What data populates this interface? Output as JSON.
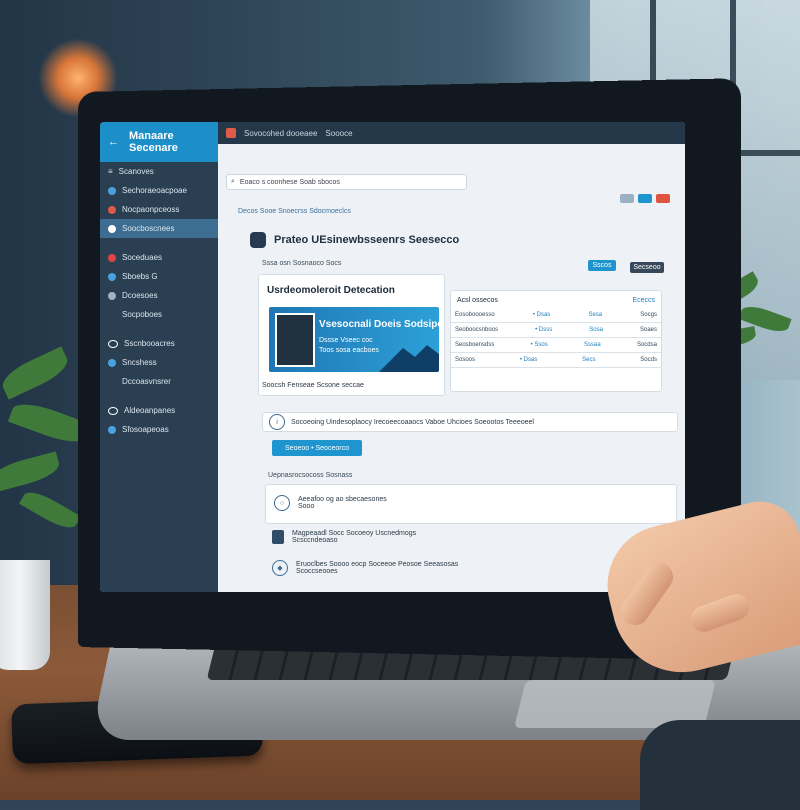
{
  "scene": {
    "description_colors": {
      "accent": "#1e95cf",
      "sidebar": "#2a3f52",
      "topbar": "#253849"
    }
  },
  "app": {
    "sidebar_title": "Manaare Secenare",
    "sidebar_items": [
      {
        "label": "Scanoves",
        "icon": "menu-icon"
      },
      {
        "label": "Sechoraeoacpoae",
        "icon": "user-icon"
      },
      {
        "label": "Nocpaonpceoss",
        "icon": "folder-icon"
      },
      {
        "label": "Soocboscnees",
        "icon": "user-icon"
      },
      {
        "label": "Soceduaes",
        "icon": "alert-icon"
      },
      {
        "label": "Sboebs G",
        "icon": "cloud-icon"
      },
      {
        "label": "Dcoesoes",
        "icon": "document-icon"
      },
      {
        "label": "Socpoboes",
        "icon": "settings-icon"
      },
      {
        "label": "Sscnbooacres",
        "icon": "eye-icon"
      },
      {
        "label": "Sncshess",
        "icon": "check-icon"
      },
      {
        "label": "Dccoasvnsrer",
        "icon": "list-icon"
      },
      {
        "label": "Aldeoanpanes",
        "icon": "shield-icon"
      },
      {
        "label": "Sfosoapeoas",
        "icon": "gear-icon"
      }
    ],
    "topbar": {
      "tab_label": "Sovocohed dooeaee",
      "second_label": "Soooce",
      "search_text": "Eoaco s coonhese Soab sbocos"
    },
    "breadcrumb": "Decos Sooe Snoecrss Sdocmoeclcs",
    "page_title": "Prateo UEsinewbsseenrs Seesecco",
    "sub_tabs": "Sssa osn Sosnaoco Socs",
    "buttons": {
      "primary": "Sscos",
      "secondary": "Secseoo",
      "action": "Seoeoo • Seoceorco"
    },
    "card_left": {
      "title": "Usrdeomoleroit Detecation",
      "image_headline": "Vsesocnali Doeis Sodsipes",
      "image_line1": "Dssse Vseec coc",
      "image_line2": "Toos sosa eacboes",
      "footer": "Soocsh Fenseae Scsone  seccae"
    },
    "card_right": {
      "title": "Acsl ossecos",
      "link": "Ececcs",
      "rows": [
        {
          "label": "Eosoboooesso",
          "mid": "• Dsas",
          "value": "Sesa",
          "right": "Socgs"
        },
        {
          "label": "Seoboocsnboos",
          "mid": "• Dsss",
          "value": "Sosa",
          "right": "Soaes"
        },
        {
          "label": "Seosboensdss",
          "mid": "• Ssos",
          "value": "Sssaa",
          "right": "Socdsa"
        },
        {
          "label": "Sosoos",
          "mid": "• Dsas",
          "value": "Secs",
          "right": "Socds"
        }
      ]
    },
    "info_bar": "Socoeoing Uindesoplaocy Irecoeecoaaocs Vaboe Uhcioes Soeootos Teeeoeel",
    "section_label": "Uepnasrocsocoss Sosnass",
    "list_items": [
      {
        "title": "Aeeafoo og ao sbecaesones",
        "sub": "Sooo"
      },
      {
        "title": "Magpeaadl Socc Socoeoy Uscnedmogs",
        "sub": "Scsccndeoaso"
      },
      {
        "title": "Eruoclbes Soooo eocp Soceeoe Peosoe Seeasosas",
        "sub": "Scoccseooes"
      }
    ]
  }
}
